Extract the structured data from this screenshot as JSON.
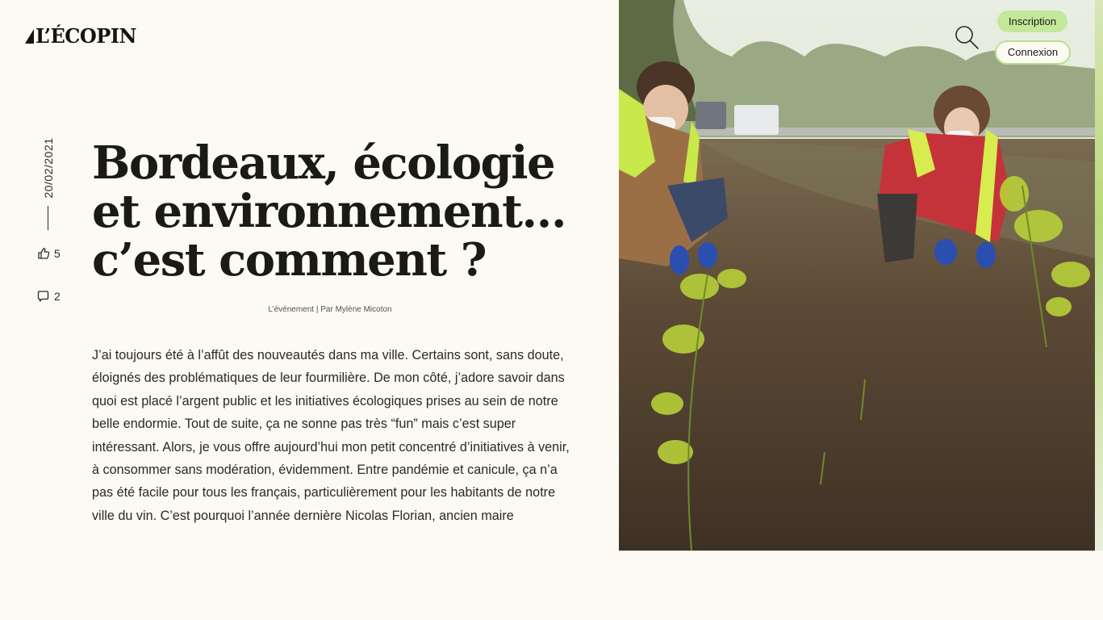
{
  "brand": {
    "name": "L’ÉCOPIN",
    "icon": "sail-logo-icon"
  },
  "header": {
    "search_icon": "search-icon",
    "signup_label": "Inscription",
    "login_label": "Connexion"
  },
  "article": {
    "date": "20/02/2021",
    "likes": "5",
    "comments": "2",
    "title": "Bordeaux, écologie et environnement… c’est comment ?",
    "byline": "L’événement | Par Mylène Micoton",
    "body": "J’ai toujours été à l’affût des nouveautés dans ma ville. Certains sont, sans doute, éloignés des problématiques de leur fourmilière. De mon côté, j’adore savoir dans quoi est placé l’argent public et les initiatives écologiques prises au sein de notre belle endormie. Tout de suite, ça ne sonne pas très “fun” mais c’est super intéressant. Alors, je vous offre aujourd’hui mon petit concentré d’initiatives à venir, à consommer sans modération, évidemment. Entre pandémie et canicule, ça n’a pas été facile pour tous les français, particulièrement pour les habitants de notre ville du vin. C’est pourquoi l’année dernière Nicolas Florian, ancien maire"
  },
  "icons": {
    "likes": "thumbs-up-icon",
    "comments": "comment-icon"
  },
  "colors": {
    "background": "#fcfaf2",
    "accent_green": "#c3e89a",
    "text": "#1a1a17"
  }
}
